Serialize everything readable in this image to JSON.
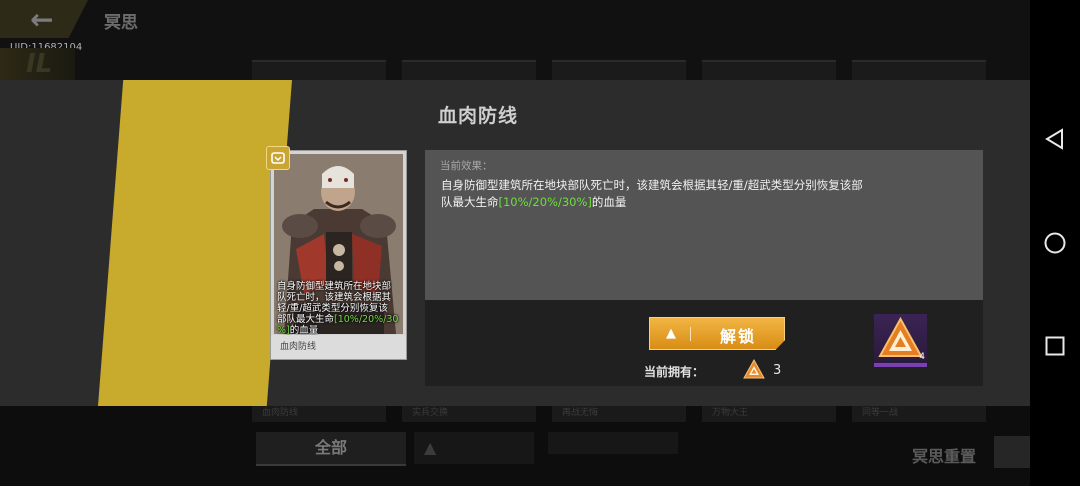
{
  "background": {
    "back_glyph": "←",
    "page_title": "冥思",
    "uid": "UID:11682104",
    "deco_text": "IL",
    "bottom_items": [
      "血肉防线",
      "实兵交换",
      "再战无悔",
      "万物大王",
      "同等一战"
    ],
    "filter_all": "全部",
    "reset_label": "冥思重置"
  },
  "modal": {
    "title": "血肉防线",
    "card": {
      "name": "血肉防线",
      "desc_before": "自身防御型建筑所在地块部\n队死亡时，该建筑会根据其\n轻/重/超武类型分别恢复该\n部队最大生命",
      "desc_highlight": "[10%/20%/30\n%]",
      "desc_after": "的血量"
    },
    "effect": {
      "label": "当前效果：",
      "text_before": "自身防御型建筑所在地块部队死亡时，该建筑会根据其轻/重/超武类型分别恢复该部\n队最大生命",
      "text_highlight": "[10%/20%/30%]",
      "text_after": "的血量"
    },
    "unlock_button": "解锁",
    "owned_label": "当前拥有：",
    "owned_count": "3",
    "item_quantity": "4"
  },
  "colors": {
    "accent_yellow": "#c8aa2c",
    "button_orange": "#e6a02a",
    "highlight_green": "#6ede3e",
    "item_purple": "#7a3fb0"
  },
  "icons": {
    "back": "back-arrow-icon",
    "unlock_arrow": "up-arrow-icon",
    "currency": "triangle-token-icon",
    "nav_back": "triangle-back-icon",
    "nav_home": "circle-home-icon",
    "nav_recent": "square-recent-icon"
  }
}
